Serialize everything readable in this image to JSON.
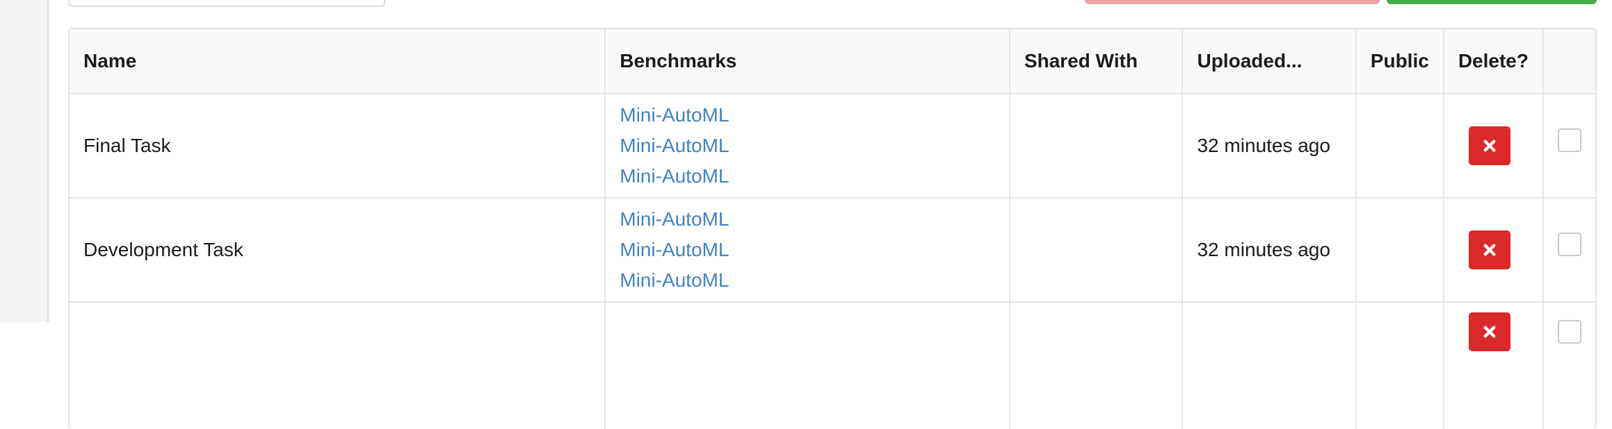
{
  "table": {
    "headers": [
      "Name",
      "Benchmarks",
      "Shared With",
      "Uploaded...",
      "Public",
      "Delete?",
      ""
    ],
    "rows": [
      {
        "name": "Final Task",
        "benchmarks": [
          "Mini-AutoML",
          "Mini-AutoML",
          "Mini-AutoML"
        ],
        "shared_with": "",
        "uploaded": "32 minutes ago",
        "public": ""
      },
      {
        "name": "Development Task",
        "benchmarks": [
          "Mini-AutoML",
          "Mini-AutoML",
          "Mini-AutoML"
        ],
        "shared_with": "",
        "uploaded": "32 minutes ago",
        "public": ""
      },
      {
        "name": "",
        "benchmarks": [],
        "shared_with": "",
        "uploaded": "",
        "public": ""
      }
    ]
  },
  "colors": {
    "link": "#4183c4",
    "delete": "#db2828",
    "header_bg": "#f8f9fa"
  },
  "icons": {
    "delete": "close-icon"
  }
}
